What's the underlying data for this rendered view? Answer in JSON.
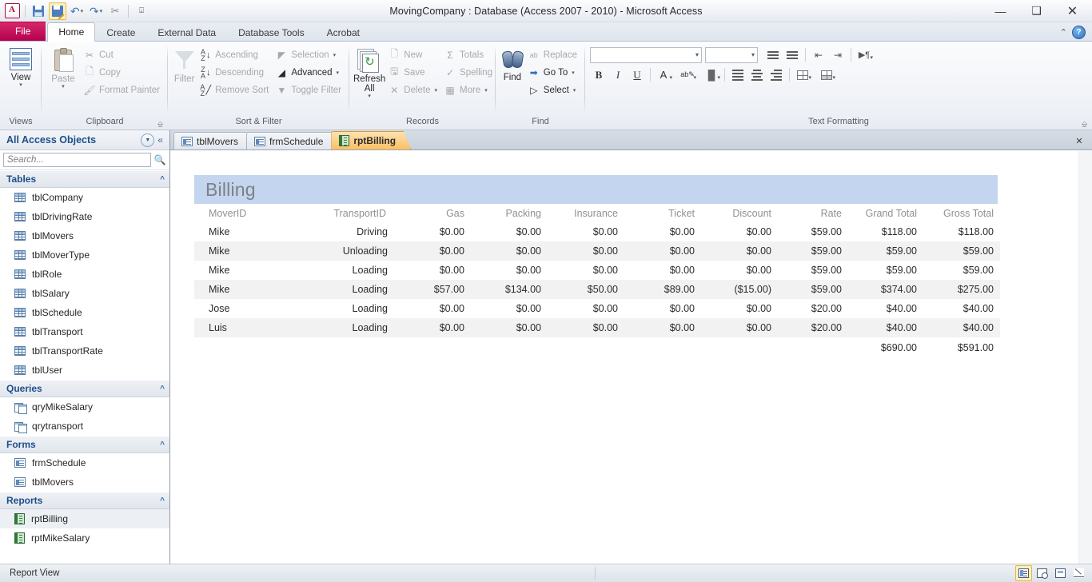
{
  "window": {
    "title": "MovingCompany : Database (Access 2007 - 2010)  -  Microsoft Access",
    "minimize": "—",
    "restore": "❐",
    "close": "✕"
  },
  "quick_access": {
    "app_logo": "A",
    "save": "save-icon",
    "save_as": "save-as-icon",
    "undo": "↶",
    "redo": "↷",
    "cut": "✂",
    "customize": "☰"
  },
  "ribbon_tabs": [
    {
      "label": "File",
      "active": false,
      "style": "file"
    },
    {
      "label": "Home",
      "active": true
    },
    {
      "label": "Create",
      "active": false
    },
    {
      "label": "External Data",
      "active": false
    },
    {
      "label": "Database Tools",
      "active": false
    },
    {
      "label": "Acrobat",
      "active": false
    }
  ],
  "ribbon_right": {
    "minimize_ribbon": "⌃",
    "help": "?"
  },
  "ribbon_groups": [
    {
      "name": "Views",
      "title": "Views",
      "big_buttons": [
        {
          "label": "View",
          "dropdown": "▾",
          "icon": "view-grid-icon",
          "disabled": false
        }
      ],
      "has_launcher": false
    },
    {
      "name": "Clipboard",
      "title": "Clipboard",
      "big_buttons": [
        {
          "label": "Paste",
          "dropdown": "▾",
          "icon": "paste-icon",
          "disabled": true
        }
      ],
      "small_buttons": [
        {
          "label": "Cut",
          "icon": "scissors-icon",
          "disabled": true
        },
        {
          "label": "Copy",
          "icon": "copy-icon",
          "disabled": true
        },
        {
          "label": "Format Painter",
          "icon": "brush-icon",
          "disabled": true
        }
      ],
      "has_launcher": true
    },
    {
      "name": "Sort & Filter",
      "title": "Sort & Filter",
      "big_buttons": [
        {
          "label": "Filter",
          "icon": "funnel-icon",
          "disabled": true
        }
      ],
      "small_buttons": [
        {
          "label": "Ascending",
          "icon": "sort-ascending-icon",
          "disabled": true
        },
        {
          "label": "Descending",
          "icon": "sort-descending-icon",
          "disabled": true
        },
        {
          "label": "Remove Sort",
          "icon": "remove-sort-icon",
          "disabled": true
        }
      ],
      "small_buttons2": [
        {
          "label": "Selection",
          "icon": "selection-icon",
          "disabled": true,
          "dropdown": "▾"
        },
        {
          "label": "Advanced",
          "icon": "advanced-filter-icon",
          "disabled": false,
          "dropdown": "▾"
        },
        {
          "label": "Toggle Filter",
          "icon": "toggle-filter-icon",
          "disabled": true
        }
      ],
      "has_launcher": false
    },
    {
      "name": "Records",
      "title": "Records",
      "big_buttons": [
        {
          "label": "Refresh All",
          "dropdown": "▾",
          "icon": "refresh-icon",
          "disabled": false
        }
      ],
      "small_buttons": [
        {
          "label": "New",
          "icon": "new-record-icon",
          "disabled": true
        },
        {
          "label": "Save",
          "icon": "save-record-icon",
          "disabled": true
        },
        {
          "label": "Delete",
          "icon": "delete-icon",
          "disabled": true,
          "dropdown": "▾"
        }
      ],
      "small_buttons2": [
        {
          "label": "Totals",
          "icon": "sigma-icon",
          "disabled": true
        },
        {
          "label": "Spelling",
          "icon": "spelling-icon",
          "disabled": true
        },
        {
          "label": "More",
          "icon": "more-icon",
          "disabled": true,
          "dropdown": "▾"
        }
      ],
      "has_launcher": false
    },
    {
      "name": "Find",
      "title": "Find",
      "big_buttons": [
        {
          "label": "Find",
          "icon": "binoculars-icon",
          "disabled": false
        }
      ],
      "small_buttons": [
        {
          "label": "Replace",
          "icon": "replace-icon",
          "disabled": true
        },
        {
          "label": "Go To",
          "icon": "go-to-icon",
          "disabled": false,
          "dropdown": "▾"
        },
        {
          "label": "Select",
          "icon": "select-cursor-icon",
          "disabled": false,
          "dropdown": "▾"
        }
      ],
      "has_launcher": false
    }
  ],
  "text_formatting": {
    "title": "Text Formatting",
    "font_name": "",
    "font_size": "",
    "buttons": [
      {
        "name": "bullets",
        "glyph": "•≡"
      },
      {
        "name": "numbering",
        "glyph": "1≡"
      },
      {
        "name": "decrease-indent",
        "glyph": "⇤"
      },
      {
        "name": "increase-indent",
        "glyph": "⇥"
      },
      {
        "name": "text-direction",
        "glyph": "¶"
      },
      {
        "name": "bold",
        "glyph": "B"
      },
      {
        "name": "italic",
        "glyph": "I"
      },
      {
        "name": "underline",
        "glyph": "U"
      },
      {
        "name": "font-color",
        "glyph": "A"
      },
      {
        "name": "highlight-color",
        "glyph": "ab"
      },
      {
        "name": "background-color",
        "glyph": "◆"
      },
      {
        "name": "align-left",
        "glyph": "≡"
      },
      {
        "name": "align-center",
        "glyph": "≡"
      },
      {
        "name": "align-right",
        "glyph": "≡"
      },
      {
        "name": "gridlines",
        "glyph": "▦"
      },
      {
        "name": "alternate-row-color",
        "glyph": "▤"
      }
    ]
  },
  "navigation_pane": {
    "title": "All Access Objects",
    "dropdown_icon": "▾",
    "collapse_icon": "«",
    "search": {
      "placeholder": "Search...",
      "value": "",
      "icon": "search-icon"
    },
    "groups": [
      {
        "label": "Tables",
        "chevron": "⌃",
        "icon_type": "table",
        "items": [
          {
            "label": "tblCompany"
          },
          {
            "label": "tblDrivingRate"
          },
          {
            "label": "tblMovers"
          },
          {
            "label": "tblMoverType"
          },
          {
            "label": "tblRole"
          },
          {
            "label": "tblSalary"
          },
          {
            "label": "tblSchedule"
          },
          {
            "label": "tblTransport"
          },
          {
            "label": "tblTransportRate"
          },
          {
            "label": "tblUser"
          }
        ]
      },
      {
        "label": "Queries",
        "chevron": "⌃",
        "icon_type": "query",
        "items": [
          {
            "label": "qryMikeSalary"
          },
          {
            "label": "qrytransport"
          }
        ]
      },
      {
        "label": "Forms",
        "chevron": "⌃",
        "icon_type": "form",
        "items": [
          {
            "label": "frmSchedule"
          },
          {
            "label": "tblMovers"
          }
        ]
      },
      {
        "label": "Reports",
        "chevron": "⌃",
        "icon_type": "report",
        "items": [
          {
            "label": "rptBilling",
            "selected": true
          },
          {
            "label": "rptMikeSalary"
          }
        ]
      }
    ]
  },
  "document_tabs": {
    "tabs": [
      {
        "label": "tblMovers",
        "icon": "form-icon",
        "active": false
      },
      {
        "label": "frmSchedule",
        "icon": "form-icon",
        "active": false
      },
      {
        "label": "rptBilling",
        "icon": "report-icon",
        "active": true
      }
    ],
    "close_icon": "✕"
  },
  "report": {
    "title": "Billing",
    "columns": [
      "MoverID",
      "TransportID",
      "Gas",
      "Packing",
      "Insurance",
      "Ticket",
      "Discount",
      "Rate",
      "Grand Total",
      "Gross Total"
    ],
    "rows": [
      {
        "mover": "Mike",
        "transport": "Driving",
        "gas": "$0.00",
        "packing": "$0.00",
        "insurance": "$0.00",
        "ticket": "$0.00",
        "discount": "$0.00",
        "rate": "$59.00",
        "grand_total": "$118.00",
        "gross_total": "$118.00"
      },
      {
        "mover": "Mike",
        "transport": "Unloading",
        "gas": "$0.00",
        "packing": "$0.00",
        "insurance": "$0.00",
        "ticket": "$0.00",
        "discount": "$0.00",
        "rate": "$59.00",
        "grand_total": "$59.00",
        "gross_total": "$59.00"
      },
      {
        "mover": "Mike",
        "transport": "Loading",
        "gas": "$0.00",
        "packing": "$0.00",
        "insurance": "$0.00",
        "ticket": "$0.00",
        "discount": "$0.00",
        "rate": "$59.00",
        "grand_total": "$59.00",
        "gross_total": "$59.00"
      },
      {
        "mover": "Mike",
        "transport": "Loading",
        "gas": "$57.00",
        "packing": "$134.00",
        "insurance": "$50.00",
        "ticket": "$89.00",
        "discount": "($15.00)",
        "rate": "$59.00",
        "grand_total": "$374.00",
        "gross_total": "$275.00"
      },
      {
        "mover": "Jose",
        "transport": "Loading",
        "gas": "$0.00",
        "packing": "$0.00",
        "insurance": "$0.00",
        "ticket": "$0.00",
        "discount": "$0.00",
        "rate": "$20.00",
        "grand_total": "$40.00",
        "gross_total": "$40.00"
      },
      {
        "mover": "Luis",
        "transport": "Loading",
        "gas": "$0.00",
        "packing": "$0.00",
        "insurance": "$0.00",
        "ticket": "$0.00",
        "discount": "$0.00",
        "rate": "$20.00",
        "grand_total": "$40.00",
        "gross_total": "$40.00"
      }
    ],
    "totals": {
      "grand_total": "$690.00",
      "gross_total": "$591.00"
    }
  },
  "status_bar": {
    "text": "Report View",
    "view_buttons": [
      {
        "name": "report-view-button",
        "selected": true
      },
      {
        "name": "print-preview-button",
        "selected": false
      },
      {
        "name": "layout-view-button",
        "selected": false
      },
      {
        "name": "design-view-button",
        "selected": false
      }
    ]
  },
  "colors": {
    "accent_blue": "#c3d5ef",
    "file_tab": "#b3004e",
    "active_doc_tab": "#fbbf63",
    "nav_header_text": "#1d4f8a"
  }
}
